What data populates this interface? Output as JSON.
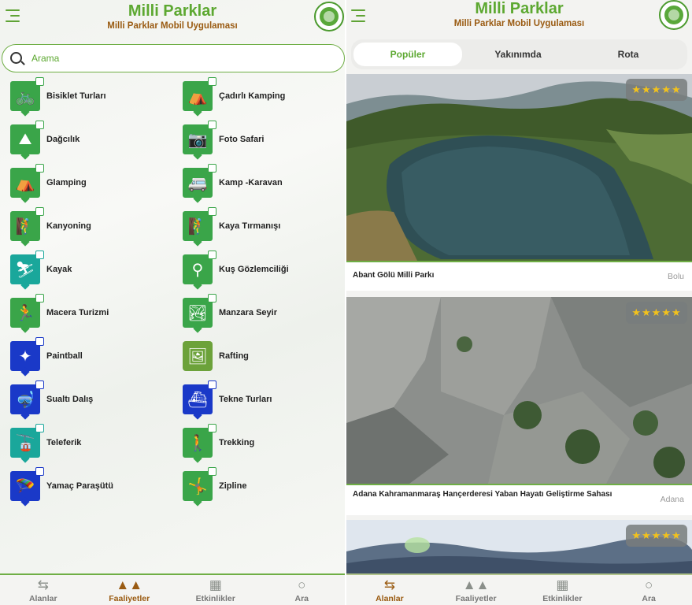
{
  "header": {
    "title": "Milli Parklar",
    "subtitle": "Milli Parklar Mobil Uygulaması"
  },
  "search": {
    "placeholder": "Arama"
  },
  "activities": [
    {
      "label": "Bisiklet Turları",
      "icon": "bicycle-icon",
      "color": "#3aa549"
    },
    {
      "label": "Çadırlı Kamping",
      "icon": "tent-icon",
      "color": "#3aa549"
    },
    {
      "label": "Dağcılık",
      "icon": "mountain-icon",
      "color": "#3aa549"
    },
    {
      "label": "Foto Safari",
      "icon": "camera-icon",
      "color": "#3aa549"
    },
    {
      "label": "Glamping",
      "icon": "glamping-tent-icon",
      "color": "#3aa549"
    },
    {
      "label": "Kamp -Karavan",
      "icon": "caravan-icon",
      "color": "#3aa549"
    },
    {
      "label": "Kanyoning",
      "icon": "canyoning-icon",
      "color": "#3aa549"
    },
    {
      "label": "Kaya Tırmanışı",
      "icon": "rock-climbing-icon",
      "color": "#3aa549"
    },
    {
      "label": "Kayak",
      "icon": "ski-icon",
      "color": "#1aa79b"
    },
    {
      "label": "Kuş Gözlemciliği",
      "icon": "binoculars-icon",
      "color": "#3aa549"
    },
    {
      "label": "Macera Turizmi",
      "icon": "adventure-icon",
      "color": "#3aa549"
    },
    {
      "label": "Manzara Seyir",
      "icon": "landscape-view-icon",
      "color": "#3aa549"
    },
    {
      "label": "Paintball",
      "icon": "paintball-icon",
      "color": "#1a39c8"
    },
    {
      "label": "Rafting",
      "icon": "image-placeholder-icon",
      "color": "#6ca23a"
    },
    {
      "label": "Sualtı Dalış",
      "icon": "diving-icon",
      "color": "#1a39c8"
    },
    {
      "label": "Tekne Turları",
      "icon": "boat-icon",
      "color": "#1a39c8"
    },
    {
      "label": "Teleferik",
      "icon": "cable-car-icon",
      "color": "#1aa79b"
    },
    {
      "label": "Trekking",
      "icon": "trekking-icon",
      "color": "#3aa549"
    },
    {
      "label": "Yamaç Paraşütü",
      "icon": "paragliding-icon",
      "color": "#1a39c8"
    },
    {
      "label": "Zipline",
      "icon": "zipline-icon",
      "color": "#3aa549"
    }
  ],
  "nav": {
    "items": [
      {
        "label": "Alanlar",
        "icon": "signpost-icon"
      },
      {
        "label": "Faaliyetler",
        "icon": "trees-icon"
      },
      {
        "label": "Etkinlikler",
        "icon": "calendar-icon"
      },
      {
        "label": "Ara",
        "icon": "search-icon"
      }
    ],
    "left_active": "Faaliyetler",
    "right_active": "Alanlar"
  },
  "tabs": [
    {
      "label": "Popüler"
    },
    {
      "label": "Yakınımda"
    },
    {
      "label": "Rota"
    }
  ],
  "active_tab": "Popüler",
  "parks": [
    {
      "name": "Abant Gölü Milli Parkı",
      "city": "Bolu",
      "stars": "★★★★★",
      "rating": 5
    },
    {
      "name": "Adana Kahramanmaraş Hançerderesi Yaban Hayatı Geliştirme Sahası",
      "city": "Adana",
      "stars": "★★★★★",
      "rating": 5
    },
    {
      "name": "",
      "city": "",
      "stars": "★★★★★",
      "rating": 5
    }
  ],
  "colors": {
    "accent_green": "#5da831",
    "subtitle_brown": "#9a5b12",
    "icon_green": "#3aa549",
    "icon_blue": "#1a39c8",
    "icon_teal": "#1aa79b"
  }
}
